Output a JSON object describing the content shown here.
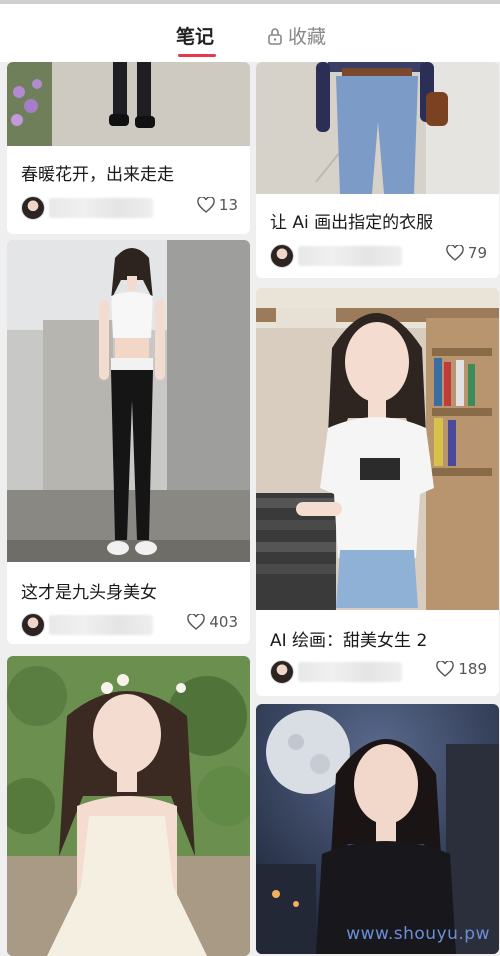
{
  "tabs": {
    "notes": "笔记",
    "favorites": "收藏"
  },
  "cards": [
    {
      "title": "春暖花开，出来走走",
      "likes": "13"
    },
    {
      "title": "这才是九头身美女",
      "likes": "403"
    },
    {
      "title": "",
      "likes": ""
    },
    {
      "title": "让 Ai 画出指定的衣服",
      "likes": "79"
    },
    {
      "title": "AI 绘画：甜美女生 2",
      "likes": "189"
    },
    {
      "title": "",
      "likes": ""
    }
  ],
  "watermark": "www.shouyu.pw",
  "colors": {
    "accent": "#e8384f",
    "background": "#efefef",
    "card": "#ffffff"
  }
}
